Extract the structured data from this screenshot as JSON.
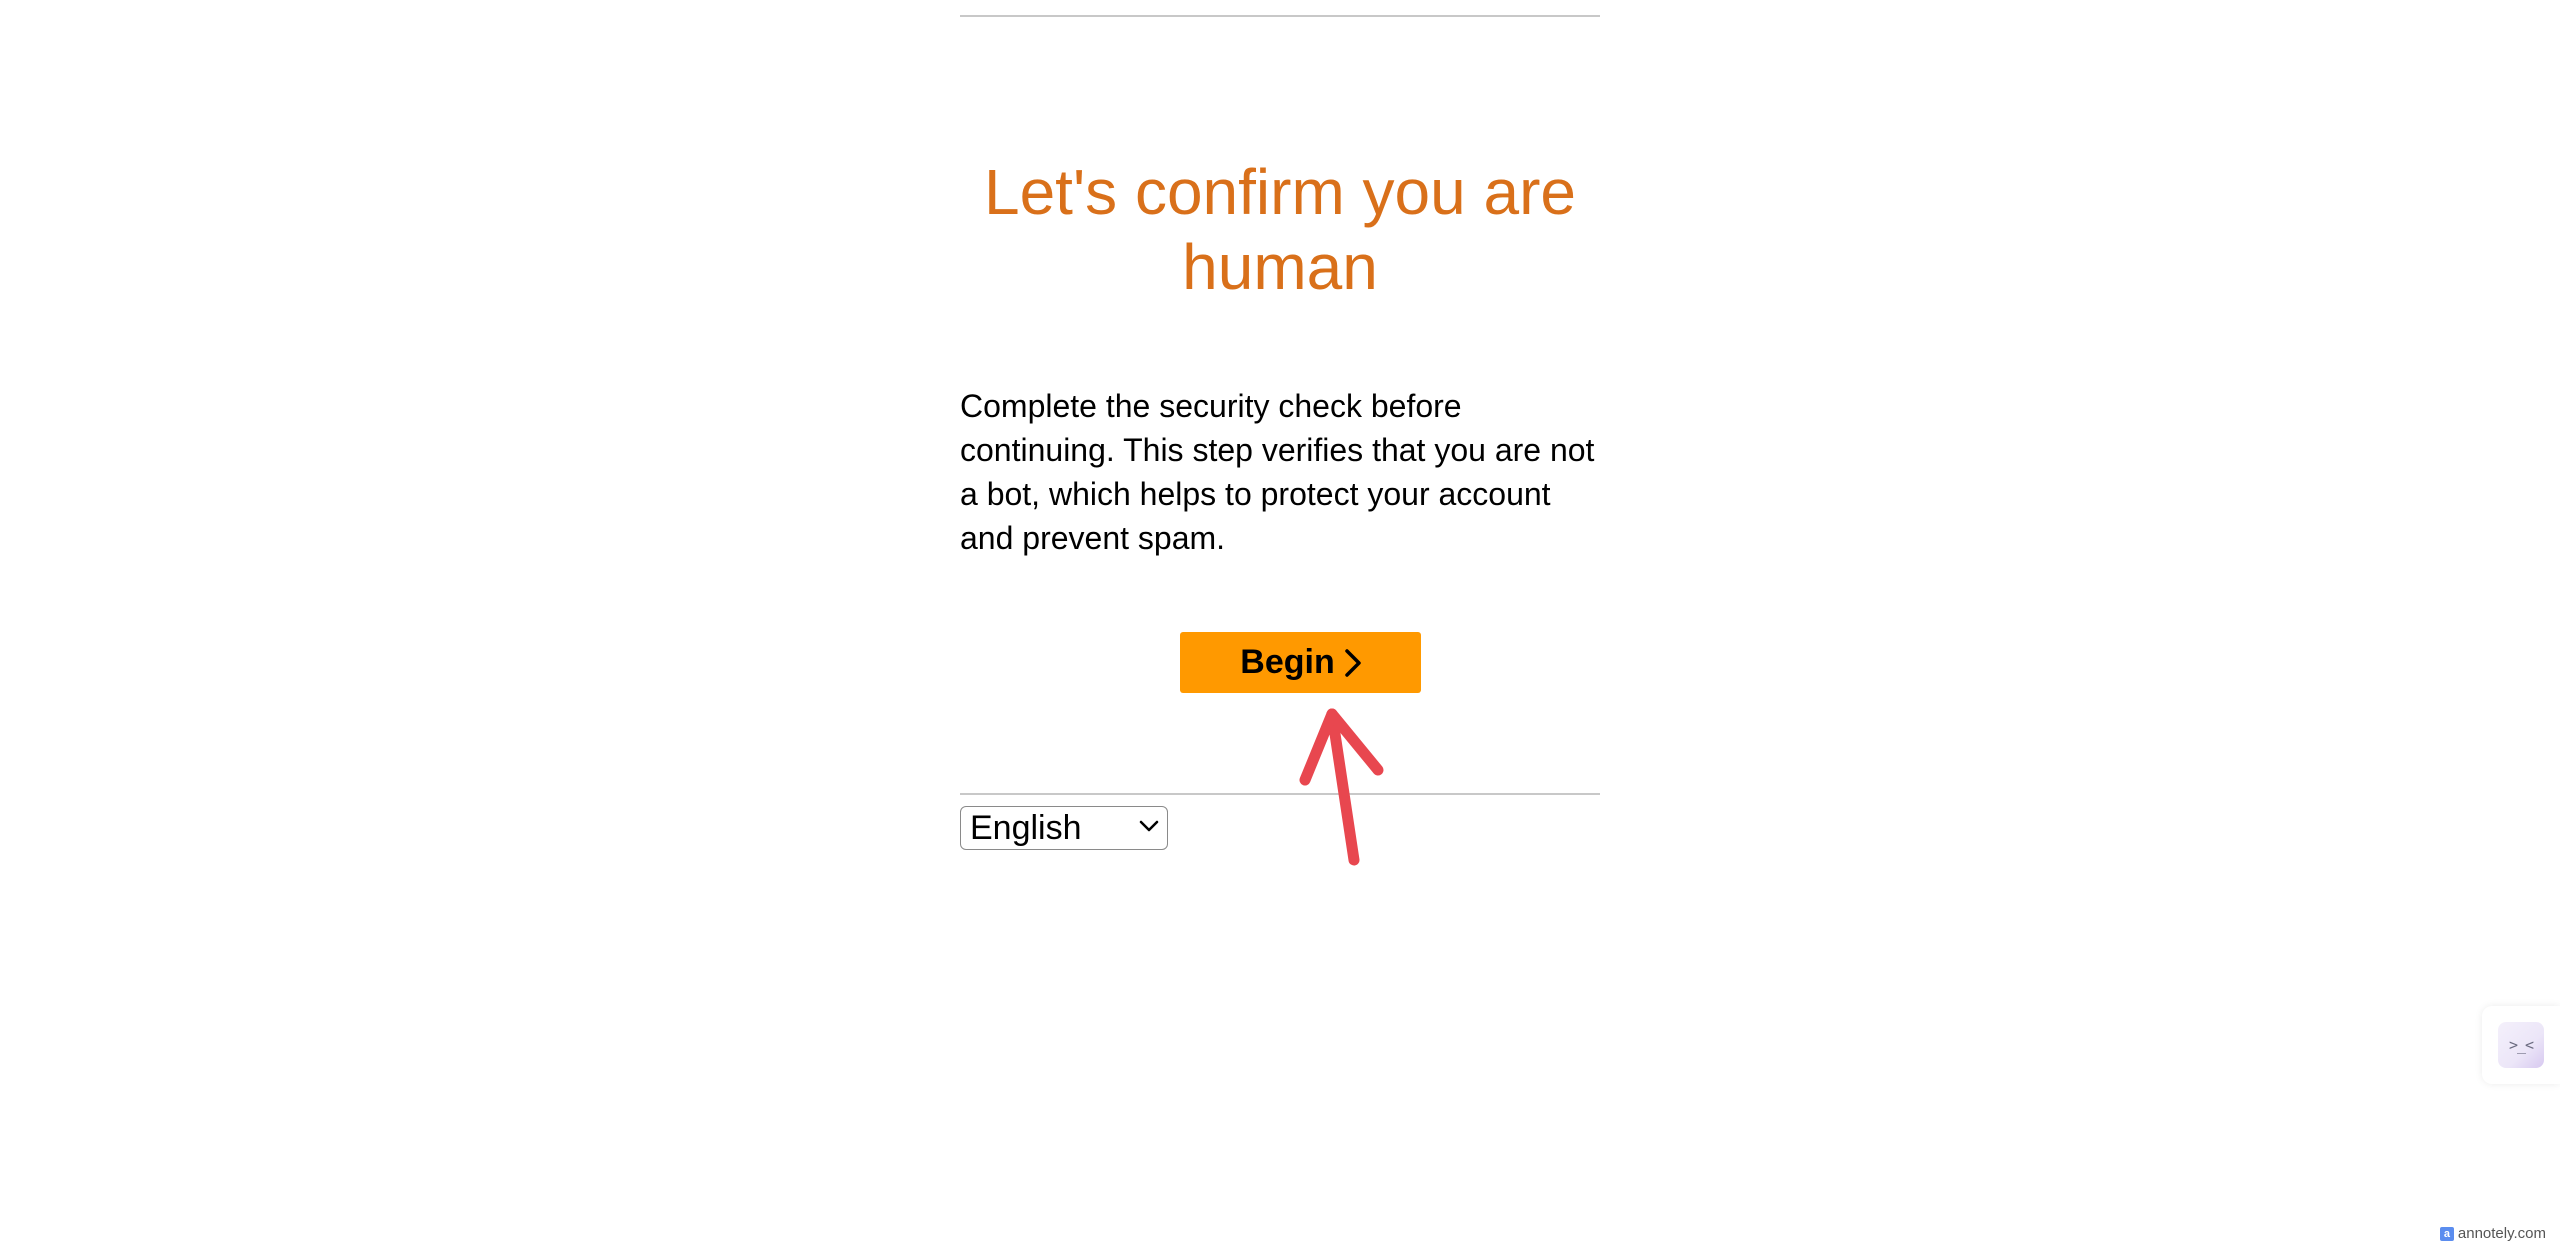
{
  "heading": {
    "line1": "Let's confirm you are",
    "line2": "human"
  },
  "description": "Complete the security check before continuing. This step verifies that you are not a bot, which helps to protect your account and prevent spam.",
  "begin_button": {
    "label": "Begin",
    "icon": "chevron-right-icon",
    "color": "#ff9900"
  },
  "language_select": {
    "selected": "English",
    "icon": "chevron-down-icon"
  },
  "colors": {
    "heading": "#d9701a",
    "annotation_arrow": "#e8474f"
  },
  "side_widget": {
    "icon": "face-icon",
    "face_text": ">_<"
  },
  "watermark": {
    "text": "annotely.com"
  }
}
